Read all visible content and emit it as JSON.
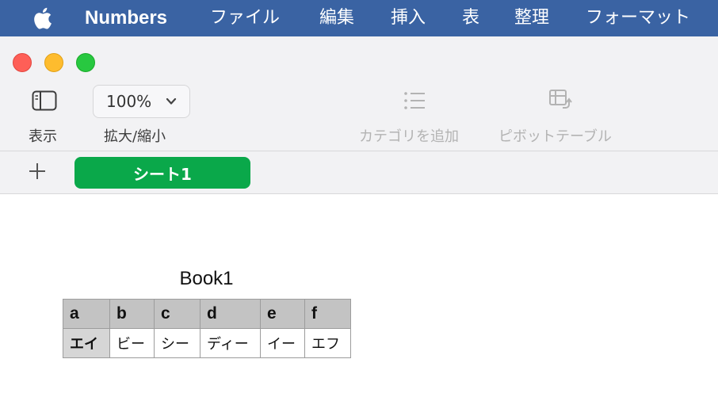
{
  "menubar": {
    "app_name": "Numbers",
    "items": [
      "ファイル",
      "編集",
      "挿入",
      "表",
      "整理",
      "フォーマット"
    ]
  },
  "toolbar": {
    "view_label": "表示",
    "zoom_value": "100%",
    "zoom_label": "拡大/縮小",
    "category_label": "カテゴリを追加",
    "pivot_label": "ピボットテーブル"
  },
  "sheets": {
    "active_tab": "シート1"
  },
  "table": {
    "title": "Book1",
    "headers": [
      "a",
      "b",
      "c",
      "d",
      "e",
      "f"
    ],
    "rows": [
      [
        "エイ",
        "ビー",
        "シー",
        "ディー",
        "イー",
        "エフ"
      ]
    ]
  },
  "colors": {
    "menubar": "#3a63a3",
    "sheet_tab": "#0aa84a",
    "header_fill": "#c3c3c3"
  },
  "icons": [
    "apple-icon",
    "sidebar-icon",
    "chevron-down-icon",
    "list-icon",
    "pivot-table-icon",
    "plus-icon"
  ]
}
